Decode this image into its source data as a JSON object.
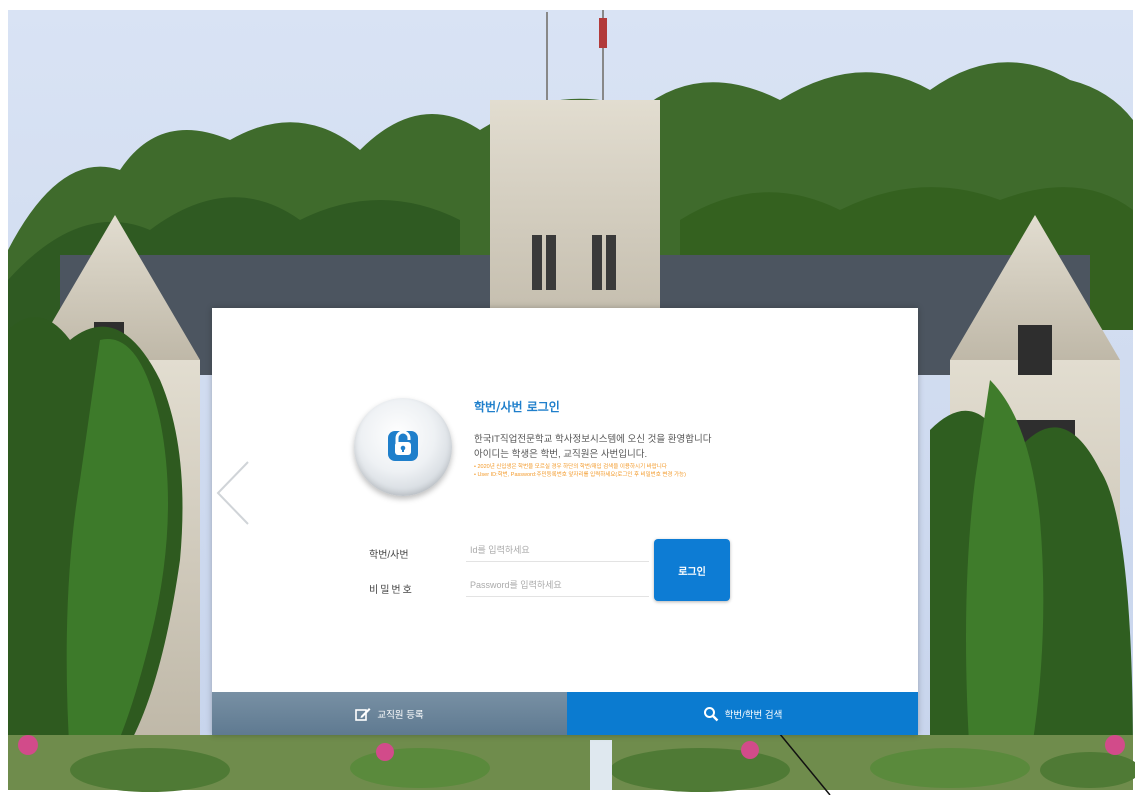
{
  "login": {
    "title": "학번/사번 로그인",
    "welcome_line1": "한국IT직업전문학교 학사정보시스템에 오신 것을 환영합니다",
    "welcome_line2": "아이디는 학생은 학번, 교직원은 사번입니다.",
    "note_line1": "• 2020년 신입생은 학번을 모르실 경우 하단의 학번/재입 검색을 이용하시기 바랍니다",
    "note_line2": "• User ID:학번, Password:주민등록번호 앞자리를 입력하세요(로그인 후 비밀번호 변경 가능)",
    "id_label": "학번/사번",
    "id_placeholder": "Id를 입력하세요",
    "pw_label": "비밀번호",
    "pw_placeholder": "Password를 입력하세요",
    "login_button": "로그인"
  },
  "bottom_bar": {
    "staff_register": "교직원 등록",
    "search": "학번/학번 검색"
  },
  "colors": {
    "accent": "#0b7bd0",
    "title": "#1f7fcb",
    "note": "#f39a2a",
    "bar_left": "#6a8499"
  },
  "icons": [
    "lock-icon",
    "edit-icon",
    "search-icon",
    "chevron-left-icon"
  ]
}
